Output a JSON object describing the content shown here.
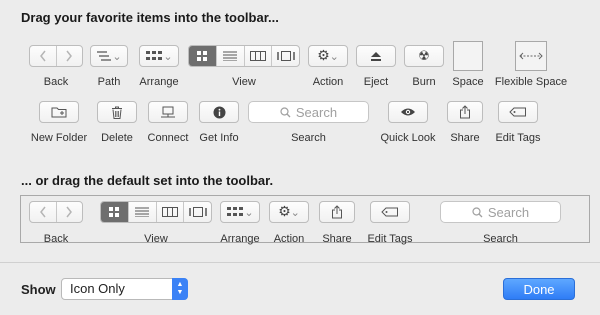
{
  "headings": {
    "palette": "Drag your favorite items into the toolbar...",
    "default": "... or drag the default set into the toolbar."
  },
  "palette_items": {
    "back": "Back",
    "path": "Path",
    "arrange": "Arrange",
    "view": "View",
    "action": "Action",
    "eject": "Eject",
    "burn": "Burn",
    "space": "Space",
    "flexible_space": "Flexible Space",
    "new_folder": "New Folder",
    "delete": "Delete",
    "connect": "Connect",
    "get_info": "Get Info",
    "search": "Search",
    "quick_look": "Quick Look",
    "share": "Share",
    "edit_tags": "Edit Tags"
  },
  "search_placeholder": "Search",
  "default_set": {
    "back": "Back",
    "view": "View",
    "arrange": "Arrange",
    "action": "Action",
    "share": "Share",
    "edit_tags": "Edit Tags",
    "search": "Search"
  },
  "footer": {
    "show_label": "Show",
    "show_value": "Icon Only",
    "done_label": "Done"
  },
  "colors": {
    "accent": "#3b82f6",
    "selected_segment": "#6e6e6e",
    "background": "#ececec"
  }
}
